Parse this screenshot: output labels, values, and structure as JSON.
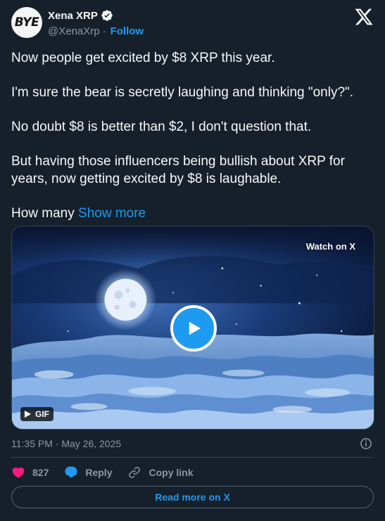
{
  "author": {
    "avatar_text": "BYE",
    "display_name": "Xena XRP",
    "handle": "@XenaXrp",
    "separator": "·",
    "follow_label": "Follow",
    "verified_color": "#1d9bf0"
  },
  "tweet": {
    "paragraphs": [
      "Now people get excited by $8 XRP this year.",
      "I'm sure the bear is secretly laughing and thinking \"only?\".",
      "No doubt $8 is better than $2, I don't question that.",
      "But having those influencers being bullish about XRP for years, now getting excited by $8 is laughable."
    ],
    "truncated_text": "How many ",
    "show_more_label": "Show more"
  },
  "media": {
    "watch_label": "Watch on X",
    "gif_label": "GIF",
    "play_icon": "play-icon"
  },
  "meta": {
    "timestamp": "11:35 PM · May 26, 2025"
  },
  "actions": {
    "like_count": "827",
    "reply_label": "Reply",
    "copy_link_label": "Copy link",
    "read_more_label": "Read more on X"
  },
  "colors": {
    "background": "#15202b",
    "accent": "#1d9bf0",
    "like": "#f91880",
    "muted": "#8b98a5"
  }
}
